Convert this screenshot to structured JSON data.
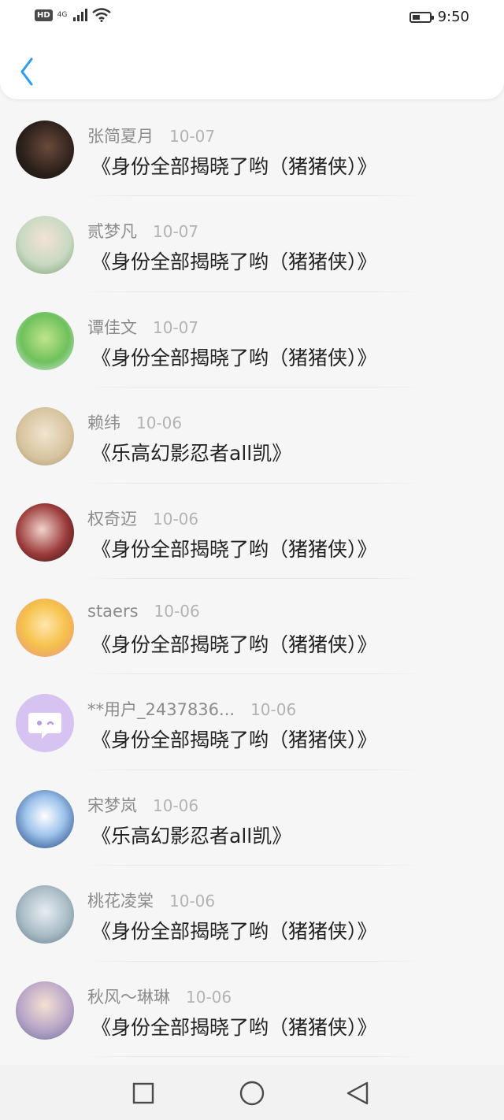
{
  "status_bar": {
    "hd_badge": "HD",
    "network_label": "4G",
    "time": "9:50",
    "battery_level": 0.45
  },
  "header": {
    "back_icon": "chevron-left-icon"
  },
  "list": [
    {
      "name": "张简夏月",
      "date": "10-07",
      "title": "《身份全部揭晓了哟（猪猪侠）》",
      "avatar": "photo-avatar"
    },
    {
      "name": "贰梦凡",
      "date": "10-07",
      "title": "《身份全部揭晓了哟（猪猪侠）》",
      "avatar": "photo-avatar"
    },
    {
      "name": "谭佳文",
      "date": "10-07",
      "title": "《身份全部揭晓了哟（猪猪侠）》",
      "avatar": "anime-avatar"
    },
    {
      "name": "赖纬",
      "date": "10-06",
      "title": "《乐高幻影忍者all凯》",
      "avatar": "photo-avatar"
    },
    {
      "name": "权奇迈",
      "date": "10-06",
      "title": "《身份全部揭晓了哟（猪猪侠）》",
      "avatar": "photo-avatar"
    },
    {
      "name": "staers",
      "date": "10-06",
      "title": "《身份全部揭晓了哟（猪猪侠）》",
      "avatar": "anime-avatar"
    },
    {
      "name": "**用户_2437836...",
      "date": "10-06",
      "title": "《身份全部揭晓了哟（猪猪侠）》",
      "avatar": "default-chat-avatar"
    },
    {
      "name": "宋梦岚",
      "date": "10-06",
      "title": "《乐高幻影忍者all凯》",
      "avatar": "photo-avatar"
    },
    {
      "name": "桃花凌棠",
      "date": "10-06",
      "title": "《身份全部揭晓了哟（猪猪侠）》",
      "avatar": "anime-avatar"
    },
    {
      "name": "秋风～琳琳",
      "date": "10-06",
      "title": "《身份全部揭晓了哟（猪猪侠）》",
      "avatar": "anime-avatar"
    }
  ],
  "nav_bar": {
    "recent_icon": "square-icon",
    "home_icon": "circle-icon",
    "back_icon": "triangle-back-icon"
  },
  "colors": {
    "accent": "#2a9df4",
    "name_gray": "#8c8c8c",
    "date_gray": "#b3b3b3",
    "title_text": "#222222",
    "default_avatar_bg": "#d7c3f2"
  }
}
